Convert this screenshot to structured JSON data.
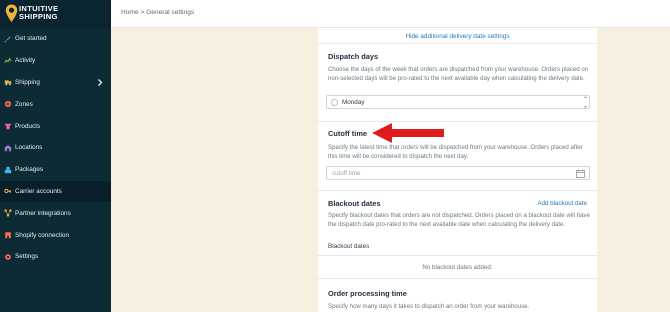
{
  "brand": {
    "line1": "INTUITIVE",
    "line2": "SHIPPING"
  },
  "breadcrumb": {
    "home": "Home",
    "sep": ">",
    "current": "General settings"
  },
  "sidebar": {
    "items": [
      {
        "label": "Get started",
        "icon": "rocket-icon"
      },
      {
        "label": "Activity",
        "icon": "activity-icon"
      },
      {
        "label": "Shipping",
        "icon": "truck-icon",
        "chevron": true
      },
      {
        "label": "Zones",
        "icon": "globe-icon"
      },
      {
        "label": "Products",
        "icon": "tshirt-icon"
      },
      {
        "label": "Locations",
        "icon": "warehouse-icon"
      },
      {
        "label": "Packages",
        "icon": "boxes-icon"
      },
      {
        "label": "Carrier accounts",
        "icon": "key-icon",
        "active": true
      },
      {
        "label": "Partner integrations",
        "icon": "integrations-icon"
      },
      {
        "label": "Shopify connection",
        "icon": "shop-icon"
      },
      {
        "label": "Settings",
        "icon": "gear-icon"
      }
    ]
  },
  "card": {
    "hide_link": "Hide additional delivery date settings",
    "dispatch": {
      "title": "Dispatch days",
      "desc": "Choose the days of the week that orders are dispatched from your warehouse. Orders placed on non-selected days will be pro-rated to the next available day when calculating the delivery date.",
      "option": "Monday"
    },
    "cutoff": {
      "title": "Cutoff time",
      "desc": "Specify the latest time that orders will be dispatched from your warehouse. Orders placed after this time will be considered to dispatch the next day.",
      "placeholder": "cutoff time"
    },
    "blackout": {
      "title": "Blackout dates",
      "add": "Add blackout date",
      "desc": "Specify blackout dates that orders are not dispatched. Orders placed on a blackout date will have the dispatch date pro-rated to the next available date when calculating the delivery date.",
      "label": "Blackout dates",
      "empty": "No blackout dates added."
    },
    "processing": {
      "title": "Order processing time",
      "desc": "Specify how many days it takes to dispatch an order from your warehouse."
    }
  },
  "colors": {
    "sidebar": "#0c2b35",
    "accent": "#f2b33d",
    "link": "#2a7ab8",
    "arrow": "#e01b1b",
    "background": "#f7f0e1"
  }
}
